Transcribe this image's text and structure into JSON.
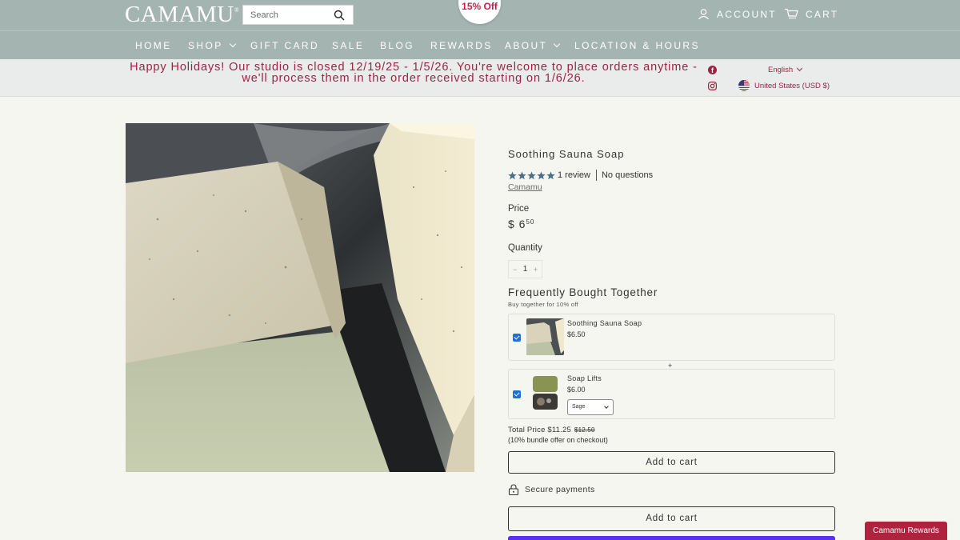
{
  "header": {
    "logo": "CAMAMU",
    "logo_mark": "®",
    "search_placeholder": "Search",
    "promo_badge": "15% Off",
    "account_label": "ACCOUNT",
    "cart_label": "CART"
  },
  "nav": {
    "items": [
      {
        "label": "HOME"
      },
      {
        "label": "SHOP"
      },
      {
        "label": "GIFT CARD"
      },
      {
        "label": "SALE"
      },
      {
        "label": "BLOG"
      },
      {
        "label": "REWARDS"
      },
      {
        "label": "ABOUT"
      },
      {
        "label": "LOCATION & HOURS"
      }
    ]
  },
  "announcement": {
    "text": "Happy Holidays! Our studio is closed 12/19/25 - 1/5/26. You're welcome to place orders anytime - we'll process them in the order received starting on 1/6/26.",
    "language": "English",
    "currency": "United States (USD $)"
  },
  "product": {
    "title": "Soothing Sauna Soap",
    "rating": 5,
    "reviews": "1 review",
    "questions": "No questions",
    "vendor": "Camamu",
    "price_label": "Price",
    "price_dollars": "$ 6",
    "price_cents": "50",
    "quantity_label": "Quantity",
    "quantity_value": "1",
    "quantity_minus": "−",
    "quantity_plus": "+"
  },
  "bundle": {
    "title": "Frequently Bought Together",
    "subtitle": "Buy together for 10% off",
    "plus": "+",
    "items": [
      {
        "name": "Soothing Sauna Soap",
        "price": "$6.50",
        "checked": true
      },
      {
        "name": "Soap Lifts",
        "price": "$6.00",
        "checked": true,
        "variant": "Sage"
      }
    ],
    "total_label": "Total Price $11.25",
    "total_original": "$12.50",
    "bundle_note": "(10% bundle offer on checkout)",
    "add_to_cart": "Add to cart"
  },
  "purchase": {
    "secure_label": "Secure payments",
    "add_to_cart": "Add to cart"
  },
  "rewards_launcher": "Camamu Rewards",
  "colors": {
    "header_bg": "#a4b4b0",
    "accent": "#9c2442",
    "page_bg": "#f6f6f1",
    "shop_pay": "#5a31f4",
    "checkbox": "#1f6fd6"
  }
}
